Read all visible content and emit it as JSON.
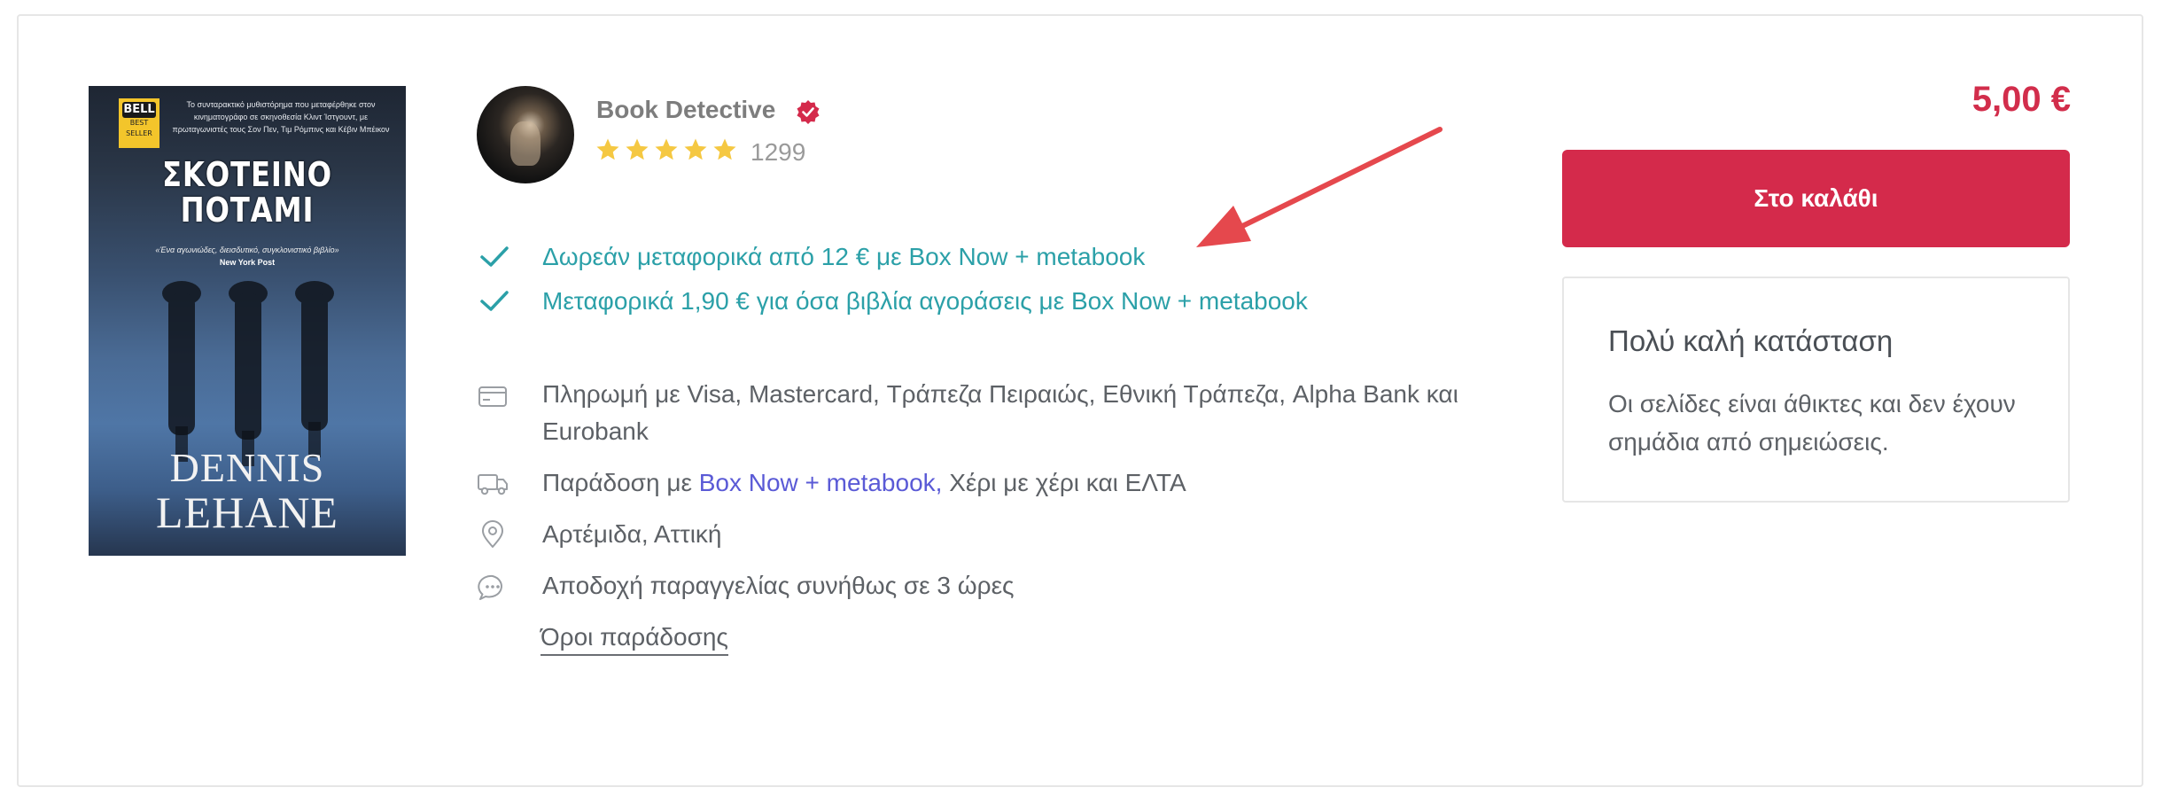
{
  "book": {
    "cover": {
      "badge_top": "BELL",
      "badge_sub": "BEST SELLER",
      "blurb": "Το συνταρακτικό μυθιστόρημα που μεταφέρθηκε στον κινηματογράφο σε σκηνοθεσία Κλιντ Ίστγουντ, με πρωταγωνιστές τους Σον Πεν, Τιμ Ρόμπινς και Κέβιν Μπέικον",
      "title_line1": "ΣΚΟΤΕΙΝΟ",
      "title_line2": "ΠΟΤΑΜΙ",
      "quote": "«Ένα αγωνιώδες, διεισδυτικό, συγκλονιστικό βιβλίο»",
      "quote_source": "New York Post",
      "author_first": "DENNIS",
      "author_last": "LEHANE"
    }
  },
  "seller": {
    "name": "Book Detective",
    "verified_icon": "verified-badge-icon",
    "rating_stars": 5,
    "rating_count": "1299",
    "colors": {
      "name": "#7d7d7d",
      "star": "#f5c842",
      "verified": "#d42a4b"
    }
  },
  "shipping_offers": [
    {
      "text": "Δωρεάν μεταφορικά από 12 € με Box Now + metabook",
      "icon": "check-icon"
    },
    {
      "text": "Μεταφορικά 1,90 € για όσα βιβλία αγοράσεις με Box Now + metabook",
      "icon": "check-icon"
    }
  ],
  "info": {
    "payment": {
      "icon": "credit-card-icon",
      "text": "Πληρωμή με Visa, Mastercard, Τράπεζα Πειραιώς, Εθνική Τράπεζα, Alpha Bank και Eurobank"
    },
    "delivery": {
      "icon": "truck-icon",
      "prefix": "Παράδοση με ",
      "link": "Box Now + metabook,",
      "suffix": " Χέρι με χέρι και ΕΛΤΑ"
    },
    "location": {
      "icon": "location-pin-icon",
      "text": "Αρτέμιδα, Αττική"
    },
    "acceptance": {
      "icon": "chat-bubble-icon",
      "text": "Αποδοχή παραγγελίας συνήθως σε 3 ώρες"
    },
    "terms_link": "Όροι παράδοσης"
  },
  "purchase": {
    "price": "5,00 €",
    "cart_button": "Στο καλάθι",
    "condition_title": "Πολύ καλή κατάσταση",
    "condition_description": "Οι σελίδες είναι άθικτες και δεν έχουν σημάδια από σημειώσεις.",
    "colors": {
      "accent": "#d42a4b",
      "offer_text": "#2ba0a8",
      "link": "#5a5ad6",
      "annotation_arrow": "#e5484d"
    }
  }
}
